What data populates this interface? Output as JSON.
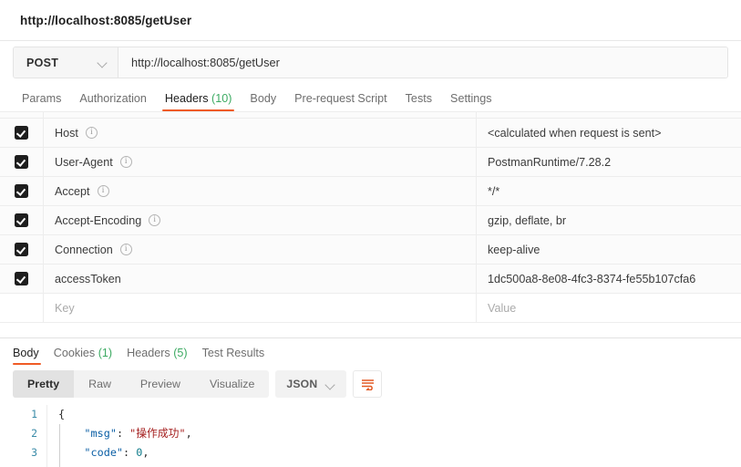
{
  "request": {
    "title": "http://localhost:8085/getUser",
    "method": "POST",
    "url": "http://localhost:8085/getUser",
    "tabs": [
      {
        "label": "Params",
        "count": "",
        "active": false
      },
      {
        "label": "Authorization",
        "count": "",
        "active": false
      },
      {
        "label": "Headers",
        "count": "(10)",
        "active": true
      },
      {
        "label": "Body",
        "count": "",
        "active": false
      },
      {
        "label": "Pre-request Script",
        "count": "",
        "active": false
      },
      {
        "label": "Tests",
        "count": "",
        "active": false
      },
      {
        "label": "Settings",
        "count": "",
        "active": false
      }
    ]
  },
  "headers_table": {
    "key_placeholder": "Key",
    "value_placeholder": "Value",
    "rows": [
      {
        "checked": true,
        "key": "Host",
        "info": true,
        "value": "<calculated when request is sent>"
      },
      {
        "checked": true,
        "key": "User-Agent",
        "info": true,
        "value": "PostmanRuntime/7.28.2"
      },
      {
        "checked": true,
        "key": "Accept",
        "info": true,
        "value": "*/*"
      },
      {
        "checked": true,
        "key": "Accept-Encoding",
        "info": true,
        "value": "gzip, deflate, br"
      },
      {
        "checked": true,
        "key": "Connection",
        "info": true,
        "value": "keep-alive"
      },
      {
        "checked": true,
        "key": "accessToken",
        "info": false,
        "value": "1dc500a8-8e08-4fc3-8374-fe55b107cfa6"
      }
    ]
  },
  "response": {
    "tabs": [
      {
        "label": "Body",
        "count": "",
        "active": true
      },
      {
        "label": "Cookies",
        "count": "(1)",
        "active": false
      },
      {
        "label": "Headers",
        "count": "(5)",
        "active": false
      },
      {
        "label": "Test Results",
        "count": "",
        "active": false
      }
    ],
    "view_modes": [
      {
        "label": "Pretty",
        "active": true
      },
      {
        "label": "Raw",
        "active": false
      },
      {
        "label": "Preview",
        "active": false
      },
      {
        "label": "Visualize",
        "active": false
      }
    ],
    "format": "JSON",
    "wrap_icon": "wrap-lines-icon",
    "body_lines": [
      {
        "num": "1",
        "tokens": [
          {
            "t": "punc",
            "v": "{"
          }
        ]
      },
      {
        "num": "2",
        "tokens": [
          {
            "t": "punc",
            "v": "    "
          },
          {
            "t": "key",
            "v": "\"msg\""
          },
          {
            "t": "punc",
            "v": ": "
          },
          {
            "t": "str",
            "v": "\"操作成功\""
          },
          {
            "t": "punc",
            "v": ","
          }
        ]
      },
      {
        "num": "3",
        "tokens": [
          {
            "t": "punc",
            "v": "    "
          },
          {
            "t": "key",
            "v": "\"code\""
          },
          {
            "t": "punc",
            "v": ": "
          },
          {
            "t": "num",
            "v": "0"
          },
          {
            "t": "punc",
            "v": ","
          }
        ]
      }
    ]
  },
  "colors": {
    "accent_orange": "#ef5b25",
    "count_green": "#3caa62",
    "json_key": "#0b5fa5",
    "json_string": "#a52020",
    "json_number": "#0f7b8a",
    "checkbox": "#1e1e1e"
  }
}
